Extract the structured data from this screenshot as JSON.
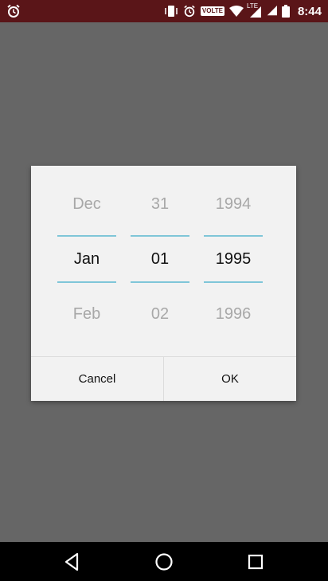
{
  "status_bar": {
    "time": "8:44",
    "volte": "VOLTE",
    "lte": "LTE",
    "icons": [
      "alarm-icon",
      "vibrate-icon",
      "alarm-icon",
      "volte-icon",
      "wifi-icon",
      "signal-icon",
      "battery-icon"
    ]
  },
  "date_picker": {
    "month": {
      "prev": "Dec",
      "current": "Jan",
      "next": "Feb"
    },
    "day": {
      "prev": "31",
      "current": "01",
      "next": "02"
    },
    "year": {
      "prev": "1994",
      "current": "1995",
      "next": "1996"
    }
  },
  "buttons": {
    "cancel": "Cancel",
    "ok": "OK"
  },
  "colors": {
    "status_bar": "#5a1518",
    "dim_background": "#666666",
    "dialog_background": "#f2f2f2",
    "picker_divider": "#7fc6d8"
  },
  "nav_bar": {
    "icons": [
      "back-icon",
      "home-icon",
      "recents-icon"
    ]
  }
}
